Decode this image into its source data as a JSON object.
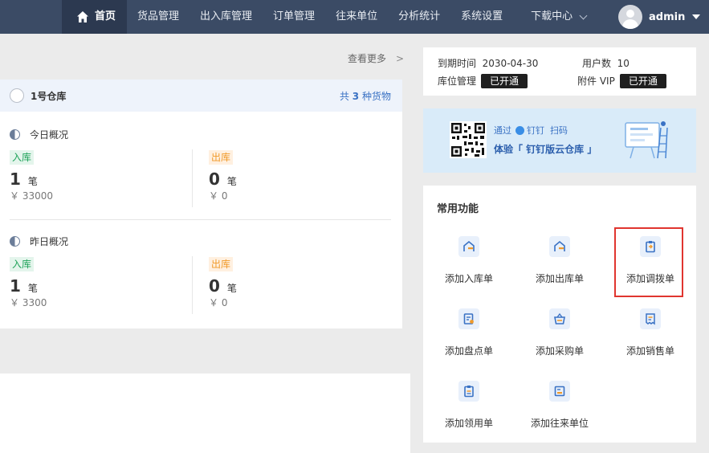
{
  "nav": {
    "items": [
      "首页",
      "货品管理",
      "出入库管理",
      "订单管理",
      "往来单位",
      "分析统计",
      "系统设置",
      "下载中心"
    ],
    "active_index": 0
  },
  "user": {
    "name": "admin"
  },
  "left": {
    "more_link": "查看更多",
    "more_arrow": ">",
    "warehouse": {
      "name": "1号仓库",
      "count_prefix": "共",
      "count": "3",
      "count_suffix": "种货物"
    },
    "sections": [
      {
        "title": "今日概况",
        "in": {
          "tag": "入库",
          "count": "1",
          "unit": "笔",
          "amount": "￥ 33000"
        },
        "out": {
          "tag": "出库",
          "count": "0",
          "unit": "笔",
          "amount": "￥ 0"
        }
      },
      {
        "title": "昨日概况",
        "in": {
          "tag": "入库",
          "count": "1",
          "unit": "笔",
          "amount": "￥ 3300"
        },
        "out": {
          "tag": "出库",
          "count": "0",
          "unit": "笔",
          "amount": "￥ 0"
        }
      }
    ]
  },
  "info": {
    "expire_label": "到期时间",
    "expire_value": "2030-04-30",
    "users_label": "用户数",
    "users_value": "10",
    "storage_label": "库位管理",
    "storage_status": "已开通",
    "vip_label": "附件 VIP",
    "vip_status": "已开通"
  },
  "banner": {
    "via": "通过",
    "app": "钉钉",
    "scan": "扫码",
    "headline": "体验「 钉钉版云仓库 」"
  },
  "functions": {
    "title": "常用功能",
    "items": [
      "添加入库单",
      "添加出库单",
      "添加调拨单",
      "添加盘点单",
      "添加采购单",
      "添加销售单",
      "添加领用单",
      "添加往来单位"
    ],
    "highlighted_index": 2
  },
  "colors": {
    "topbar": "#3b4b65",
    "accent": "#3a72c4",
    "in_tag": "#1fa35a",
    "out_tag": "#f09a2a",
    "highlight": "#e0352f"
  }
}
